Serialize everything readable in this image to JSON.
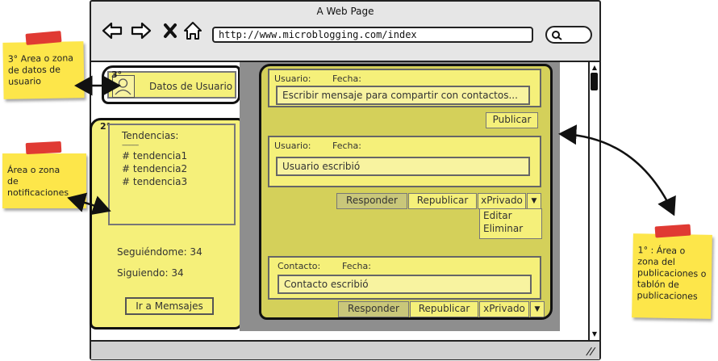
{
  "window": {
    "title": "A Web Page",
    "url": "http://www.microblogging.com/index"
  },
  "user_zone": {
    "number": "3°",
    "label": "Datos de Usuario"
  },
  "notif_zone": {
    "number": "2°",
    "trends_title": "Tendencias:",
    "trends_divider": "---------",
    "trends": [
      "# tendencia1",
      "# tendencia2",
      "# tendencia3"
    ],
    "followers": "Seguiéndome: 34",
    "following": "Siguiendo: 34",
    "messages_button": "Ir a Memsajes"
  },
  "compose": {
    "user_label": "Usuario:",
    "date_label": "Fecha:",
    "placeholder": "Escribir mensaje para compartir con contactos...",
    "publish_button": "Publicar"
  },
  "posts": [
    {
      "author_label": "Usuario:",
      "date_label": "Fecha:",
      "text": "Usuario escribió",
      "reply": "Responder",
      "repost": "Republicar",
      "private": "xPrivado",
      "menu": [
        "Editar",
        "Eliminar"
      ]
    },
    {
      "author_label": "Contacto:",
      "date_label": "Fecha:",
      "text": "Contacto escribió",
      "reply": "Responder",
      "repost": "Republicar",
      "private": "xPrivado"
    }
  ],
  "notes": {
    "user_area": "3° Area o zona de datos de usuario",
    "notifications_area": "Área o zona de notificaciones",
    "posts_area": "1° : Área o zona del publicaciones o tablón de publicaciones"
  },
  "colors": {
    "highlight": "#f5f07a",
    "sticky": "#fde64a",
    "tape": "#e03a33",
    "posts_bg": "#d4d05a"
  }
}
